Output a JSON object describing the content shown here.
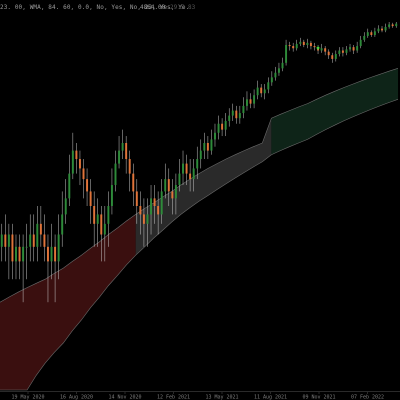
{
  "header": {
    "params_text": "23. 00, WMA, 84. 60, 0.0, No, Yes, No, 22, Yes, Ye...",
    "price_text": "4864.00",
    "tail_text": "29.5 83"
  },
  "colors": {
    "background": "#000000",
    "bull": "#2e8b3a",
    "bear": "#e0743a",
    "wick": "#c8c8c8",
    "band_red": "#3a0f0f",
    "band_gray": "#2a2a2a",
    "band_green": "#0e2418",
    "marker": "#44d644",
    "axis_text": "#7d7d7d"
  },
  "chart_data": {
    "type": "candlestick",
    "x_ticks": [
      "19 May 2020",
      "16 Aug 2020",
      "14 Nov 2020",
      "12 Feb 2021",
      "13 May 2021",
      "11 Aug 2021",
      "09 Nov 2021",
      "07 Feb 2022"
    ],
    "ylim": [
      1,
      100
    ],
    "candles": [
      [
        6,
        7,
        8,
        5
      ],
      [
        7,
        6,
        9,
        5
      ],
      [
        6,
        7,
        8,
        4
      ],
      [
        7,
        5,
        8,
        4
      ],
      [
        5,
        6,
        7,
        4
      ],
      [
        6,
        5,
        7,
        4
      ],
      [
        5,
        6,
        7,
        3
      ],
      [
        6,
        6,
        8,
        4
      ],
      [
        6,
        7,
        9,
        5
      ],
      [
        7,
        6,
        9,
        5
      ],
      [
        6,
        8,
        10,
        5
      ],
      [
        8,
        7,
        10,
        6
      ],
      [
        7,
        6,
        9,
        5
      ],
      [
        6,
        5,
        7,
        3
      ],
      [
        5,
        6,
        8,
        4
      ],
      [
        6,
        5,
        7,
        3
      ],
      [
        5,
        7,
        9,
        4
      ],
      [
        7,
        9,
        12,
        6
      ],
      [
        9,
        11,
        14,
        8
      ],
      [
        11,
        15,
        19,
        10
      ],
      [
        15,
        20,
        25,
        14
      ],
      [
        20,
        18,
        22,
        15
      ],
      [
        18,
        16,
        20,
        13
      ],
      [
        16,
        14,
        18,
        11
      ],
      [
        14,
        12,
        16,
        10
      ],
      [
        12,
        10,
        14,
        8
      ],
      [
        10,
        8,
        12,
        6
      ],
      [
        8,
        9,
        11,
        6
      ],
      [
        9,
        7,
        10,
        5
      ],
      [
        7,
        8,
        10,
        5
      ],
      [
        8,
        10,
        12,
        6
      ],
      [
        10,
        13,
        16,
        9
      ],
      [
        13,
        17,
        20,
        12
      ],
      [
        17,
        20,
        24,
        16
      ],
      [
        20,
        22,
        26,
        18
      ],
      [
        22,
        18,
        24,
        15
      ],
      [
        18,
        15,
        20,
        12
      ],
      [
        15,
        12,
        17,
        10
      ],
      [
        12,
        10,
        14,
        8
      ],
      [
        10,
        9,
        12,
        7
      ],
      [
        9,
        8,
        11,
        6
      ],
      [
        8,
        9,
        11,
        6
      ],
      [
        9,
        11,
        13,
        7
      ],
      [
        11,
        10,
        13,
        8
      ],
      [
        10,
        9,
        12,
        7
      ],
      [
        9,
        12,
        14,
        8
      ],
      [
        12,
        14,
        17,
        11
      ],
      [
        14,
        12,
        16,
        10
      ],
      [
        12,
        11,
        14,
        9
      ],
      [
        11,
        13,
        15,
        9
      ],
      [
        13,
        15,
        18,
        12
      ],
      [
        15,
        17,
        20,
        13
      ],
      [
        17,
        15,
        19,
        13
      ],
      [
        15,
        14,
        18,
        12
      ],
      [
        14,
        16,
        18,
        12
      ],
      [
        16,
        18,
        21,
        14
      ],
      [
        18,
        20,
        23,
        16
      ],
      [
        20,
        22,
        25,
        18
      ],
      [
        22,
        20,
        24,
        18
      ],
      [
        20,
        23,
        26,
        19
      ],
      [
        23,
        25,
        28,
        21
      ],
      [
        25,
        28,
        31,
        23
      ],
      [
        28,
        26,
        30,
        24
      ],
      [
        26,
        29,
        32,
        24
      ],
      [
        29,
        31,
        34,
        27
      ],
      [
        31,
        33,
        36,
        29
      ],
      [
        33,
        30,
        35,
        28
      ],
      [
        30,
        32,
        35,
        28
      ],
      [
        32,
        35,
        39,
        30
      ],
      [
        35,
        38,
        42,
        33
      ],
      [
        38,
        36,
        41,
        34
      ],
      [
        36,
        40,
        43,
        34
      ],
      [
        40,
        44,
        48,
        38
      ],
      [
        44,
        41,
        46,
        39
      ],
      [
        41,
        43,
        46,
        38
      ],
      [
        43,
        47,
        50,
        41
      ],
      [
        47,
        50,
        54,
        45
      ],
      [
        50,
        53,
        57,
        48
      ],
      [
        53,
        56,
        60,
        51
      ],
      [
        56,
        60,
        64,
        54
      ],
      [
        60,
        75,
        80,
        58
      ],
      [
        75,
        74,
        78,
        70
      ],
      [
        74,
        72,
        77,
        69
      ],
      [
        72,
        76,
        80,
        70
      ],
      [
        76,
        78,
        82,
        74
      ],
      [
        78,
        75,
        80,
        73
      ],
      [
        75,
        77,
        81,
        72
      ],
      [
        77,
        74,
        79,
        71
      ],
      [
        74,
        73,
        77,
        70
      ],
      [
        73,
        70,
        75,
        67
      ],
      [
        70,
        72,
        76,
        68
      ],
      [
        72,
        69,
        74,
        66
      ],
      [
        69,
        66,
        71,
        63
      ],
      [
        66,
        63,
        68,
        60
      ],
      [
        63,
        67,
        70,
        61
      ],
      [
        67,
        70,
        73,
        65
      ],
      [
        70,
        68,
        73,
        65
      ],
      [
        68,
        71,
        74,
        66
      ],
      [
        71,
        73,
        76,
        69
      ],
      [
        73,
        70,
        75,
        67
      ],
      [
        70,
        74,
        78,
        68
      ],
      [
        74,
        80,
        84,
        72
      ],
      [
        80,
        84,
        88,
        78
      ],
      [
        84,
        88,
        92,
        82
      ],
      [
        88,
        85,
        90,
        83
      ],
      [
        85,
        89,
        93,
        83
      ],
      [
        89,
        92,
        96,
        87
      ],
      [
        92,
        90,
        95,
        88
      ],
      [
        90,
        94,
        98,
        88
      ],
      [
        94,
        97,
        100,
        92
      ],
      [
        97,
        95,
        99,
        93
      ],
      [
        95,
        98,
        100,
        93
      ]
    ],
    "band": [
      [
        1,
        3
      ],
      [
        1,
        3.2
      ],
      [
        1,
        3.4
      ],
      [
        1,
        3.6
      ],
      [
        1.2,
        3.8
      ],
      [
        1.4,
        4
      ],
      [
        1.6,
        4.3
      ],
      [
        1.8,
        4.6
      ],
      [
        2.1,
        5
      ],
      [
        2.4,
        5.4
      ],
      [
        2.8,
        5.9
      ],
      [
        3.2,
        6.4
      ],
      [
        3.7,
        7
      ],
      [
        4.2,
        7.6
      ],
      [
        4.8,
        8.3
      ],
      [
        5.4,
        9
      ],
      [
        6,
        9.7
      ],
      [
        6.7,
        10.4
      ],
      [
        7.4,
        11.2
      ],
      [
        8.2,
        12
      ],
      [
        9,
        13
      ],
      [
        9.8,
        14
      ],
      [
        10.6,
        15
      ],
      [
        11.4,
        16
      ],
      [
        12.3,
        17
      ],
      [
        13.2,
        18
      ],
      [
        14.2,
        19
      ],
      [
        15.2,
        20
      ],
      [
        16.3,
        21
      ],
      [
        17.4,
        22
      ],
      [
        19,
        30
      ],
      [
        20,
        31.5
      ],
      [
        21,
        33
      ],
      [
        22,
        34.5
      ],
      [
        23,
        36
      ],
      [
        24.5,
        38
      ],
      [
        26,
        40
      ],
      [
        27.5,
        42
      ],
      [
        29,
        44
      ],
      [
        30.5,
        46
      ],
      [
        32,
        48
      ],
      [
        33.5,
        50
      ],
      [
        35,
        52
      ],
      [
        36.5,
        54
      ],
      [
        38,
        56
      ]
    ],
    "band_segments": [
      {
        "from": 0,
        "to": 15,
        "color": "red"
      },
      {
        "from": 15,
        "to": 30,
        "color": "gray"
      },
      {
        "from": 30,
        "to": 44,
        "color": "green"
      }
    ],
    "marker": {
      "index": 89,
      "value": 72
    }
  }
}
